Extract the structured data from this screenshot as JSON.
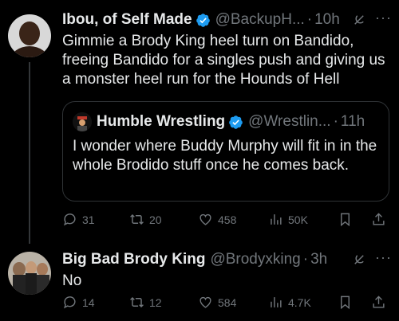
{
  "tweet1": {
    "name": "Ibou, of Self Made",
    "handle": "@BackupH...",
    "time": "10h",
    "text": "Gimmie a Brody King heel turn on Bandido, freeing Bandido for a singles push and giving us a monster heel run for the Hounds of Hell",
    "quote": {
      "name": "Humble Wrestling",
      "handle": "@Wrestlin...",
      "time": "11h",
      "text": "I wonder where Buddy Murphy will fit in in the whole Brodido stuff once he comes back."
    },
    "replies": "31",
    "reposts": "20",
    "likes": "458",
    "views": "50K"
  },
  "tweet2": {
    "name": "Big Bad Brody King",
    "handle": "@Brodyxking",
    "time": "3h",
    "text": "No",
    "replies": "14",
    "reposts": "12",
    "likes": "584",
    "views": "4.7K"
  },
  "separator": "·",
  "more_glyph": "···",
  "colors": {
    "background": "#000000",
    "text": "#e7e9ea",
    "muted": "#71767b",
    "verified": "#1d9bf0",
    "border": "#2f3336"
  }
}
